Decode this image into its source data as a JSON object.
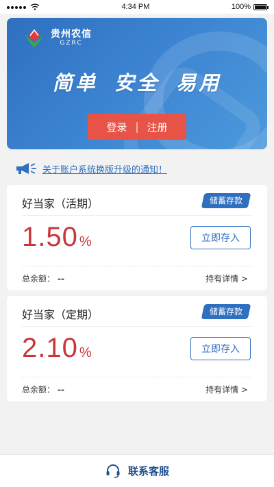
{
  "status_bar": {
    "time": "4:34 PM",
    "battery": "100%"
  },
  "hero": {
    "brand_name": "贵州农信",
    "brand_sub": "GZRC",
    "slogan": "简单 安全 易用",
    "login_label": "登录",
    "separator": "|",
    "register_label": "注册"
  },
  "notice": {
    "text": "关于账户系统换版升级的通知！"
  },
  "products": [
    {
      "title": "好当家（活期）",
      "tag": "储蓄存款",
      "rate": "1.50",
      "rate_unit": "%",
      "deposit_label": "立即存入",
      "balance_label": "总余额：",
      "balance_value": "--",
      "details_label": "持有详情 >"
    },
    {
      "title": "好当家（定期）",
      "tag": "储蓄存款",
      "rate": "2.10",
      "rate_unit": "%",
      "deposit_label": "立即存入",
      "balance_label": "总余额：",
      "balance_value": "--",
      "details_label": "持有详情 >"
    }
  ],
  "footer": {
    "service_label": "联系客服"
  },
  "colors": {
    "accent_blue": "#2f6fbf",
    "rate_red": "#c9363a",
    "auth_red": "#e85347"
  }
}
